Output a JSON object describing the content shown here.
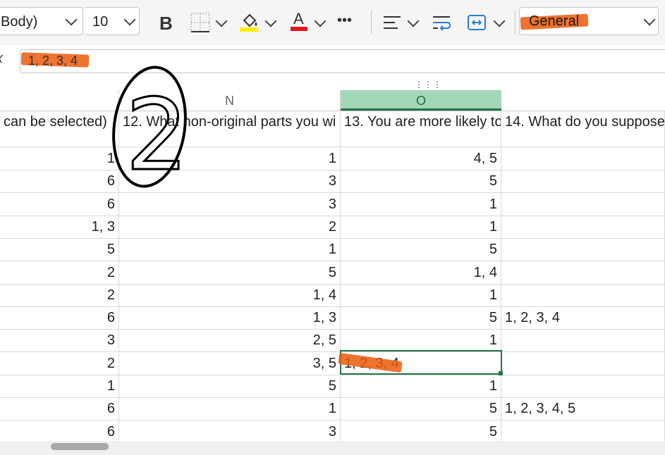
{
  "ribbon": {
    "font_name": "Body)",
    "font_size": "10",
    "bold_label": "B",
    "font_color_glyph": "A",
    "more_label": "•••",
    "number_format": "General",
    "colors": {
      "fill_yellow": "#ffef00",
      "font_red": "#e81123",
      "accent_green": "#217346"
    }
  },
  "formula_bar": {
    "fx_label": "x",
    "value": "1, 2, 3, 4"
  },
  "columns": [
    {
      "letter": "N"
    },
    {
      "letter": "O",
      "selected": true
    }
  ],
  "headers": [
    "can be selected)",
    "12. What non-original parts you wi",
    "13. You are more likely to",
    "14. What do you suppose"
  ],
  "rows": [
    [
      "1",
      "1",
      "4, 5",
      ""
    ],
    [
      "6",
      "3",
      "5",
      ""
    ],
    [
      "6",
      "3",
      "1",
      ""
    ],
    [
      "1, 3",
      "2",
      "1",
      ""
    ],
    [
      "5",
      "1",
      "5",
      ""
    ],
    [
      "2",
      "5",
      "1, 4",
      ""
    ],
    [
      "2",
      "1, 4",
      "1",
      ""
    ],
    [
      "6",
      "1, 3",
      "5",
      "1, 2, 3, 4"
    ],
    [
      "3",
      "2, 5",
      "1",
      ""
    ],
    [
      "2",
      "3, 5",
      "1, 2, 3, 4",
      ""
    ],
    [
      "1",
      "5",
      "1",
      ""
    ],
    [
      "6",
      "1",
      "5",
      "1, 2, 3, 4, 5"
    ],
    [
      "6",
      "3",
      "5",
      ""
    ]
  ],
  "annotation": {
    "handwritten_number": "2"
  }
}
